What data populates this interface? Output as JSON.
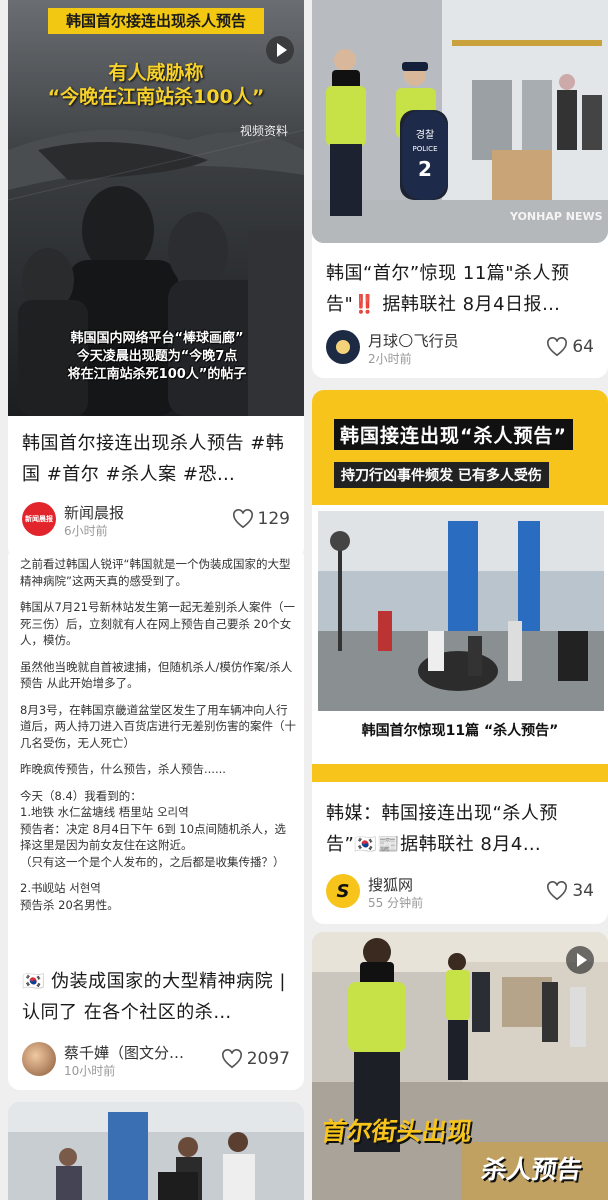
{
  "cards": [
    {
      "overlay_banner": "韩国首尔接连出现杀人预告",
      "overlay_line1": "有人威胁称",
      "overlay_line2": "“今晚在江南站杀100人”",
      "overlay_watermark": "视频资料",
      "overlay_caption1": "韩国国内网络平台“棒球画廊”",
      "overlay_caption2": "今天凌晨出现题为“今晚7点",
      "overlay_caption3": "将在江南站杀死100人”的帖子",
      "title": "韩国首尔接连出现杀人预告 #韩国 #首尔 #杀人案 #恐…",
      "author": "新闻晨报",
      "time": "6小时前",
      "likes": "129",
      "avatar_text": "新闻晨报"
    },
    {
      "title": "韩国“首尔”惊现 11篇\"杀人预告\"‼️ 据韩联社 8月4日报…",
      "author": "月球🌕飞行员",
      "time": "2小时前",
      "likes": "64",
      "image_labels": {
        "police_plate_ko": "경찰",
        "police_plate_en": "POLICE",
        "police_plate_num": "2",
        "watermark": "YONHAP NEWS"
      }
    },
    {
      "body": [
        "之前看过韩国人锐评“韩国就是一个伪装成国家的大型精神病院”这两天真的感受到了。",
        "韩国从7月21号新林站发生第一起无差别杀人案件（一死三伤）后，立刻就有人在网上预告自己要杀 20个女人，模仿。",
        "虽然他当晚就自首被逮捕，但随机杀人/模仿作案/杀人预告 从此开始增多了。",
        "8月3号，在韩国京畿道盆堂区发生了用车辆冲向人行道后，两人持刀进入百货店进行无差别伤害的案件（十几名受伤，无人死亡）",
        "昨晚疯传预告，什么预告，杀人预告......",
        "今天（8.4）我看到的：\n1.地铁 水仁盆塘线 梧里站 오리역\n预告者：决定 8月4日下午 6到 10点间随机杀人，选择这里是因为前女友住在这附近。\n（只有这一个是个人发布的，之后都是收集传播？）",
        "2.书岘站 서현역\n预告杀 20名男性。"
      ],
      "title": "🇰🇷 伪装成国家的大型精神病院 | 认同了 在各个社区的杀…",
      "author": "蔡千嬅（图文分…",
      "time": "10小时前",
      "likes": "2097"
    },
    {
      "poster_heading": "韩国接连出现“杀人预告”",
      "poster_sub": "持刀行凶事件频发 已有多人受伤",
      "poster_caption": "韩国首尔惊现11篇 “杀人预告”",
      "title": "韩媒：韩国接连出现“杀人预告”🇰🇷📰据韩联社 8月4…",
      "author": "搜狐网",
      "time": "55 分钟前",
      "likes": "34"
    },
    {
      "overlay_line1": "首尔街头出现",
      "overlay_line2": "杀人预告"
    }
  ],
  "colors": {
    "accent_yellow": "#f6c41a",
    "brand_red": "#e2242c"
  },
  "icons": [
    "heart-icon",
    "play-icon"
  ]
}
